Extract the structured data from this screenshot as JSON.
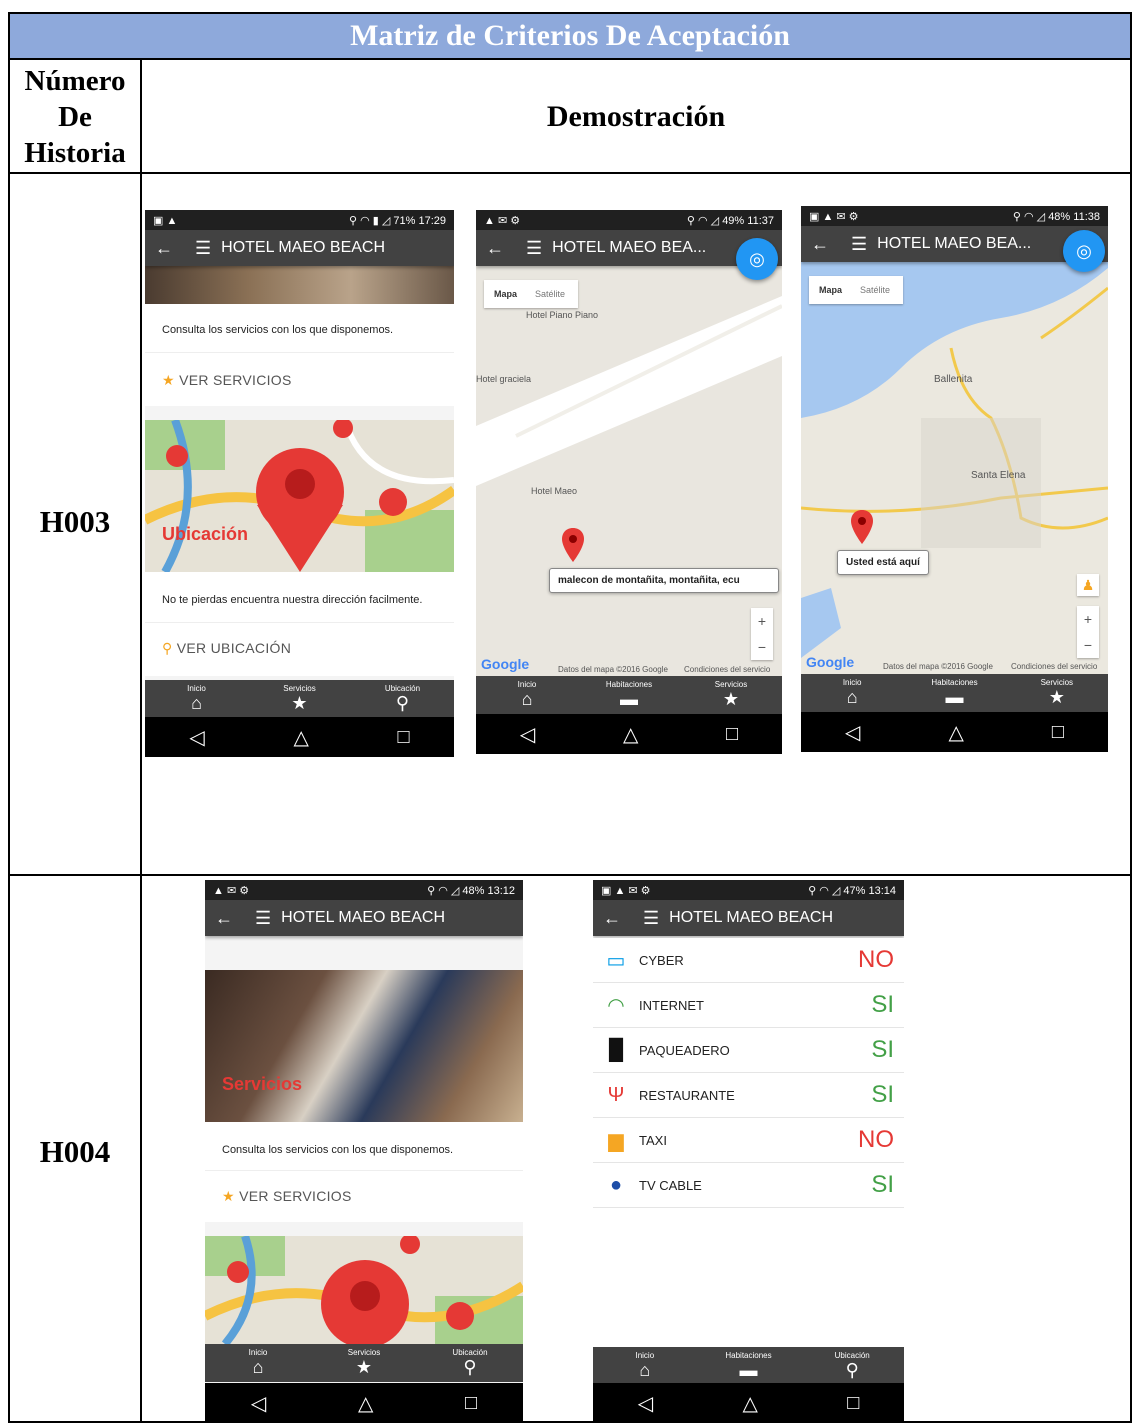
{
  "table": {
    "title": "Matriz de Criterios De Aceptación",
    "col1_header": [
      "Número",
      "De",
      "Historia"
    ],
    "col2_header": "Demostración"
  },
  "rows": [
    {
      "id": "H003"
    },
    {
      "id": "H004"
    }
  ],
  "app": {
    "title": "HOTEL MAEO BEACH",
    "title_short": "HOTEL MAEO BEA...",
    "services_desc": "Consulta los servicios con los que disponemos.",
    "services_link": "VER SERVICIOS",
    "services_overlay": "Servicios",
    "location_overlay": "Ubicación",
    "location_desc": "No te pierdas encuentra nuestra dirección facilmente.",
    "location_link": "VER UBICACIÓN"
  },
  "phones": {
    "p1": {
      "status": {
        "battery": "71%",
        "time": "17:29"
      },
      "nav": [
        "Inicio",
        "Servicios",
        "Ubicación"
      ]
    },
    "p2": {
      "status": {
        "battery": "49%",
        "time": "11:37"
      },
      "map_type": [
        "Mapa",
        "Satélite"
      ],
      "labels": [
        "Hotel Piano Piano",
        "Hotel graciela",
        "Hotel Maeo"
      ],
      "tooltip": "malecon de montañita, montañita, ecu",
      "google": "Google",
      "copyright": "Datos del mapa ©2016 Google",
      "terms": "Condiciones del servicio",
      "nav": [
        "Inicio",
        "Habitaciones",
        "Servicios"
      ]
    },
    "p3": {
      "status": {
        "battery": "48%",
        "time": "11:38"
      },
      "map_type": [
        "Mapa",
        "Satélite"
      ],
      "labels": [
        "Ballenita",
        "Santa Elena"
      ],
      "tooltip": "Usted está aquí",
      "google": "Google",
      "copyright": "Datos del mapa ©2016 Google",
      "terms": "Condiciones del servicio",
      "nav": [
        "Inicio",
        "Habitaciones",
        "Servicios"
      ]
    },
    "p4": {
      "status": {
        "battery": "48%",
        "time": "13:12"
      },
      "nav": [
        "Inicio",
        "Servicios",
        "Ubicación"
      ]
    },
    "p5": {
      "status": {
        "battery": "47%",
        "time": "13:14"
      },
      "services": [
        {
          "name": "CYBER",
          "value": "NO",
          "icon": "computer-icon",
          "color": "#e53935"
        },
        {
          "name": "INTERNET",
          "value": "SI",
          "icon": "wifi-icon",
          "color": "#43a047"
        },
        {
          "name": "PAQUEADERO",
          "value": "SI",
          "icon": "parking-icon",
          "color": "#43a047"
        },
        {
          "name": "RESTAURANTE",
          "value": "SI",
          "icon": "restaurant-icon",
          "color": "#43a047"
        },
        {
          "name": "TAXI",
          "value": "NO",
          "icon": "taxi-icon",
          "color": "#e53935"
        },
        {
          "name": "TV CABLE",
          "value": "SI",
          "icon": "globe-icon",
          "color": "#43a047"
        }
      ],
      "nav": [
        "Inicio",
        "Habitaciones",
        "Ubicación"
      ]
    }
  }
}
